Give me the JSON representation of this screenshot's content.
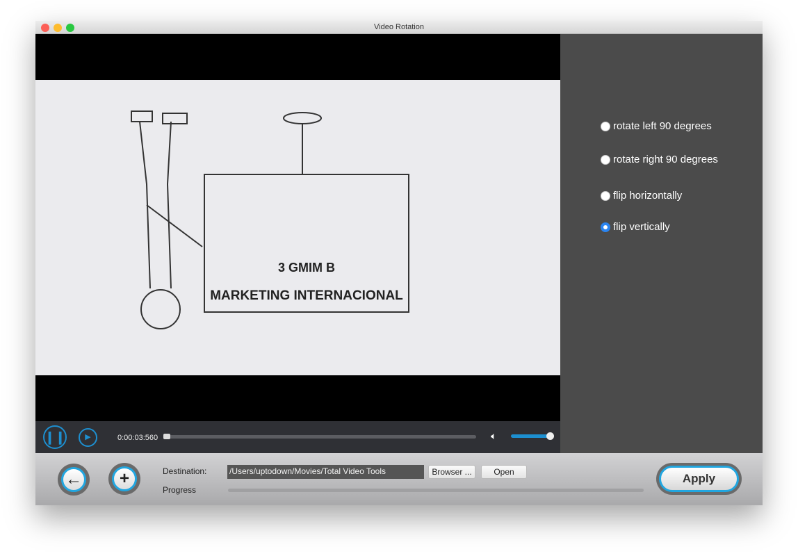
{
  "window": {
    "title": "Video Rotation"
  },
  "video": {
    "sign_line1": "3 GMIM B",
    "sign_line2": "MARKETING INTERNACIONAL"
  },
  "options": [
    {
      "label": "rotate left 90 degrees",
      "selected": false
    },
    {
      "label": "rotate right 90 degrees",
      "selected": false
    },
    {
      "label": "flip horizontally",
      "selected": false
    },
    {
      "label": "flip vertically",
      "selected": true
    }
  ],
  "player": {
    "time": "0:00:03:560",
    "progress": 0.01,
    "volume": 1.0,
    "accent": "#1d8fd0"
  },
  "bottom": {
    "destination_label": "Destination:",
    "destination_value": "/Users/uptodown/Movies/Total Video Tools",
    "browse_label": "Browser ...",
    "open_label": "Open",
    "progress_label": "Progress",
    "progress": 0,
    "apply_label": "Apply"
  }
}
